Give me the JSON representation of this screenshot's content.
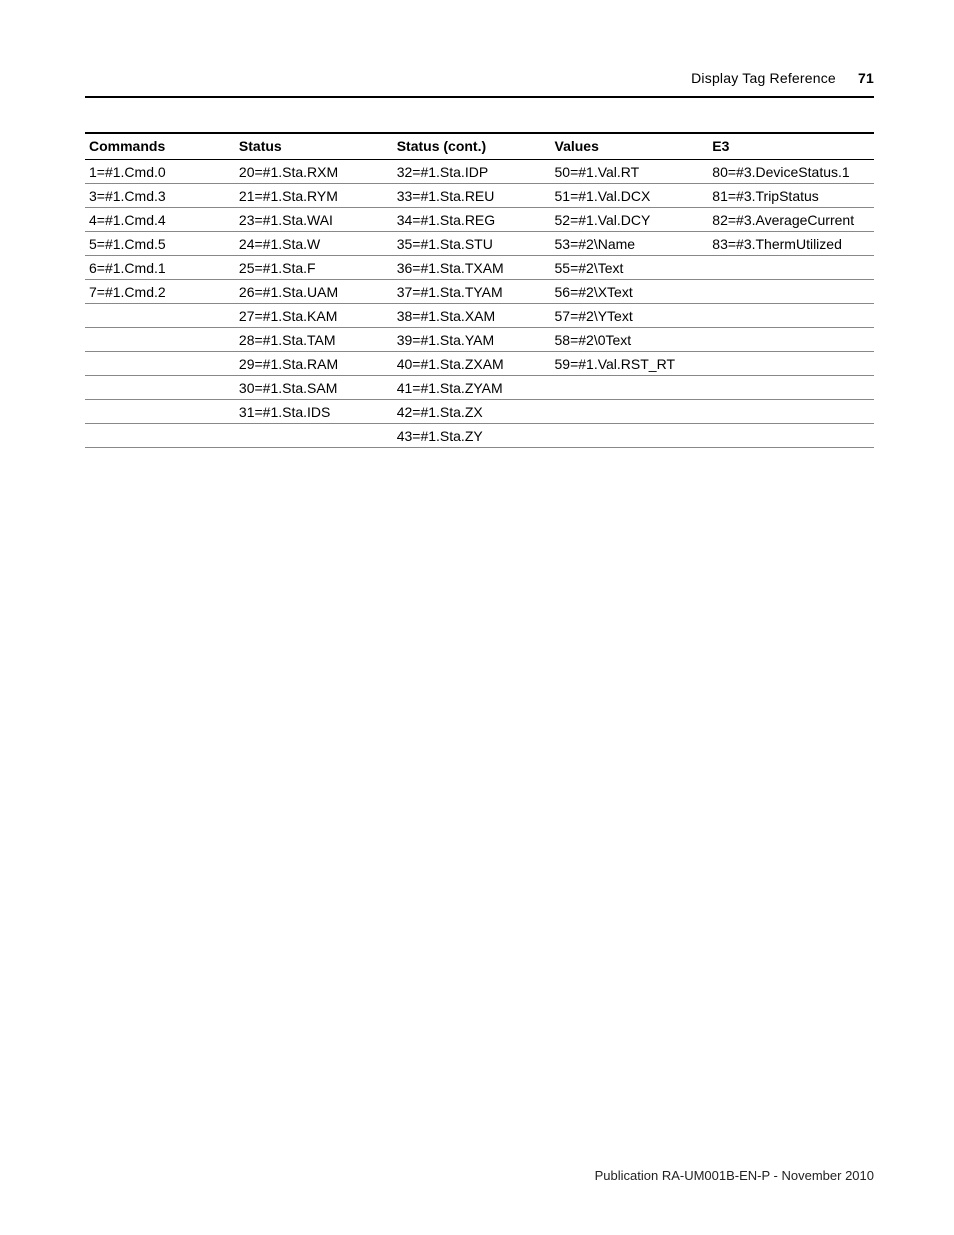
{
  "header": {
    "section_title": "Display Tag Reference",
    "page_number": "71"
  },
  "footer": {
    "publication": "Publication RA-UM001B-EN-P - November 2010"
  },
  "table": {
    "headers": [
      "Commands",
      "Status",
      "Status (cont.)",
      "Values",
      "E3"
    ],
    "columns": [
      [
        "1=#1.Cmd.0",
        "3=#1.Cmd.3",
        "4=#1.Cmd.4",
        "5=#1.Cmd.5",
        "6=#1.Cmd.1",
        "7=#1.Cmd.2"
      ],
      [
        "20=#1.Sta.RXM",
        "21=#1.Sta.RYM",
        "23=#1.Sta.WAI",
        "24=#1.Sta.W",
        "25=#1.Sta.F",
        "26=#1.Sta.UAM",
        "27=#1.Sta.KAM",
        "28=#1.Sta.TAM",
        "29=#1.Sta.RAM",
        "30=#1.Sta.SAM",
        "31=#1.Sta.IDS",
        ""
      ],
      [
        "32=#1.Sta.IDP",
        "33=#1.Sta.REU",
        "34=#1.Sta.REG",
        "35=#1.Sta.STU",
        "36=#1.Sta.TXAM",
        "37=#1.Sta.TYAM",
        "38=#1.Sta.XAM",
        "39=#1.Sta.YAM",
        "40=#1.Sta.ZXAM",
        "41=#1.Sta.ZYAM",
        "42=#1.Sta.ZX",
        "43=#1.Sta.ZY"
      ],
      [
        "50=#1.Val.RT",
        "51=#1.Val.DCX",
        "52=#1.Val.DCY",
        "53=#2\\Name",
        "55=#2\\Text",
        "56=#2\\XText",
        "57=#2\\YText",
        "58=#2\\0Text",
        "59=#1.Val.RST_RT"
      ],
      [
        "80=#3.DeviceStatus.1",
        "81=#3.TripStatus",
        "82=#3.AverageCurrent",
        "83=#3.ThermUtilized"
      ]
    ]
  }
}
